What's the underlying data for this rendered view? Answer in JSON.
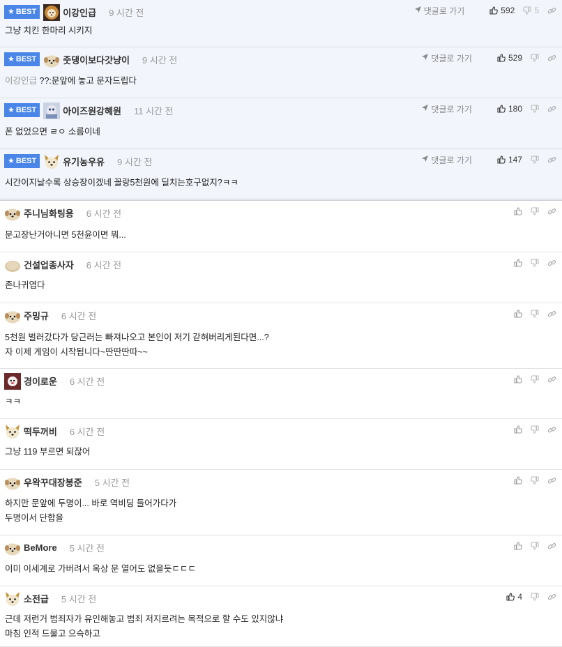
{
  "best_badge_label": "BEST",
  "goto_label": "댓글로 가기",
  "comments": [
    {
      "best": true,
      "avatar": "lion-avatar",
      "nick": "이강인급",
      "time": "9 시간 전",
      "reply_to": "",
      "lines": [
        "그냥 치킨 한마리 시키지"
      ],
      "likes": "592",
      "dislikes": "5"
    },
    {
      "best": true,
      "avatar": "puppy-avatar",
      "nick": "줏댕이보다갓냥이",
      "time": "9 시간 전",
      "reply_to": "이강인급",
      "lines": [
        "??:문앞에 놓고 문자드립다"
      ],
      "likes": "529",
      "dislikes": ""
    },
    {
      "best": true,
      "avatar": "picture-avatar",
      "nick": "아이즈원강혜원",
      "time": "11 시간 전",
      "reply_to": "",
      "lines": [
        "폰 없었으면 ㄹㅇ 소름이네"
      ],
      "likes": "180",
      "dislikes": ""
    },
    {
      "best": true,
      "avatar": "fox-avatar",
      "nick": "유기농우유",
      "time": "9 시간 전",
      "reply_to": "",
      "lines": [
        "시간이지날수록 상승장이겠네 꼴랑5천원에 딜치는호구없지?ㅋㅋ"
      ],
      "likes": "147",
      "dislikes": ""
    },
    {
      "best": false,
      "avatar": "puppy-avatar",
      "nick": "주니님화팅용",
      "time": "6 시간 전",
      "reply_to": "",
      "lines": [
        "문고장난거아니면 5천윤이면 뭐..."
      ],
      "likes": "",
      "dislikes": ""
    },
    {
      "best": false,
      "avatar": "potato-avatar",
      "nick": "건설업종사자",
      "time": "6 시간 전",
      "reply_to": "",
      "lines": [
        "존나귀엽다"
      ],
      "likes": "",
      "dislikes": ""
    },
    {
      "best": false,
      "avatar": "puppy-avatar",
      "nick": "주밍규",
      "time": "6 시간 전",
      "reply_to": "",
      "lines": [
        "5천원 벌러갔다가 당근러는 빠져나오고 본인이 저기 갇혀버리게된다면...?",
        "자 이제 게임이 시작됩니다~딴딴딴따~~"
      ],
      "likes": "",
      "dislikes": ""
    },
    {
      "best": false,
      "avatar": "photo-avatar",
      "nick": "경이로운",
      "time": "6 시간 전",
      "reply_to": "",
      "lines": [
        "ㅋㅋ"
      ],
      "likes": "",
      "dislikes": ""
    },
    {
      "best": false,
      "avatar": "fox-avatar",
      "nick": "떡두꺼비",
      "time": "6 시간 전",
      "reply_to": "",
      "lines": [
        "그냥 119 부르면 되잖어"
      ],
      "likes": "",
      "dislikes": ""
    },
    {
      "best": false,
      "avatar": "puppy-avatar",
      "nick": "우왁꾸대장봉준",
      "time": "5 시간 전",
      "reply_to": "",
      "lines": [
        "하지만 문앞에 두명이... 바로 역비딩 들어가다가",
        "두명이서 단합을"
      ],
      "likes": "",
      "dislikes": ""
    },
    {
      "best": false,
      "avatar": "puppy-avatar",
      "nick": "BeMore",
      "time": "5 시간 전",
      "reply_to": "",
      "lines": [
        "이미 이세계로 가버려서 옥상 문 열어도 없을듯ㄷㄷㄷ"
      ],
      "likes": "",
      "dislikes": ""
    },
    {
      "best": false,
      "avatar": "fox-avatar",
      "nick": "소전급",
      "time": "5 시간 전",
      "reply_to": "",
      "lines": [
        "근데 저런거 범죄자가 유인해놓고 범죄 저지르려는 목적으로 할 수도 있지않냐",
        "마침 인적 드물고 으슥하고"
      ],
      "likes": "4",
      "dislikes": ""
    }
  ]
}
